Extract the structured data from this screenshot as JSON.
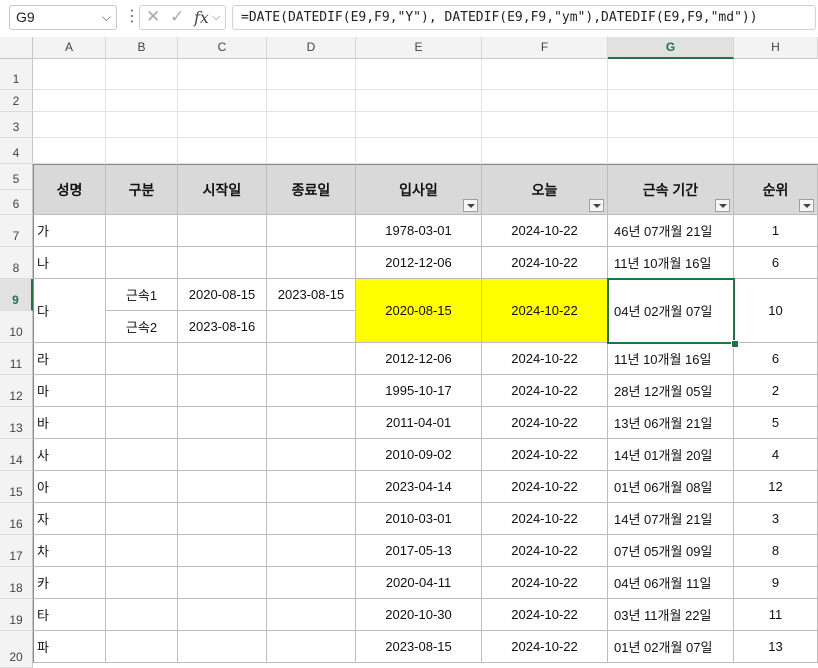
{
  "formula_bar": {
    "name_box": "G9",
    "formula": "=DATE(DATEDIF(E9,F9,\"Y\"), DATEDIF(E9,F9,\"ym\"),DATEDIF(E9,F9,\"md\"))",
    "fx_label": "fx"
  },
  "columns": [
    "A",
    "B",
    "C",
    "D",
    "E",
    "F",
    "G",
    "H"
  ],
  "selected_cell": "G9",
  "rows": [
    "1",
    "2",
    "3",
    "4",
    "5",
    "6",
    "7",
    "8",
    "9",
    "10",
    "11",
    "12",
    "13",
    "14",
    "15",
    "16",
    "17",
    "18",
    "19",
    "20"
  ],
  "table": {
    "headers": {
      "name": "성명",
      "category": "구분",
      "start": "시작일",
      "end": "종료일",
      "hire": "입사일",
      "today": "오늘",
      "tenure": "근속 기간",
      "rank": "순위"
    },
    "special": {
      "name": "다",
      "cat1": "근속1",
      "start1": "2020-08-15",
      "end1": "2023-08-15",
      "cat2": "근속2",
      "start2": "2023-08-16",
      "hire": "2020-08-15",
      "today": "2024-10-22",
      "tenure": "04년 02개월 07일",
      "rank": "10"
    },
    "rows": [
      {
        "name": "가",
        "hire": "1978-03-01",
        "today": "2024-10-22",
        "tenure": "46년 07개월 21일",
        "rank": "1"
      },
      {
        "name": "나",
        "hire": "2012-12-06",
        "today": "2024-10-22",
        "tenure": "11년 10개월 16일",
        "rank": "6"
      },
      {
        "name": "라",
        "hire": "2012-12-06",
        "today": "2024-10-22",
        "tenure": "11년 10개월 16일",
        "rank": "6"
      },
      {
        "name": "마",
        "hire": "1995-10-17",
        "today": "2024-10-22",
        "tenure": "28년 12개월 05일",
        "rank": "2"
      },
      {
        "name": "바",
        "hire": "2011-04-01",
        "today": "2024-10-22",
        "tenure": "13년 06개월 21일",
        "rank": "5"
      },
      {
        "name": "사",
        "hire": "2010-09-02",
        "today": "2024-10-22",
        "tenure": "14년 01개월 20일",
        "rank": "4"
      },
      {
        "name": "아",
        "hire": "2023-04-14",
        "today": "2024-10-22",
        "tenure": "01년 06개월 08일",
        "rank": "12"
      },
      {
        "name": "자",
        "hire": "2010-03-01",
        "today": "2024-10-22",
        "tenure": "14년 07개월 21일",
        "rank": "3"
      },
      {
        "name": "차",
        "hire": "2017-05-13",
        "today": "2024-10-22",
        "tenure": "07년 05개월 09일",
        "rank": "8"
      },
      {
        "name": "카",
        "hire": "2020-04-11",
        "today": "2024-10-22",
        "tenure": "04년 06개월 11일",
        "rank": "9"
      },
      {
        "name": "타",
        "hire": "2020-10-30",
        "today": "2024-10-22",
        "tenure": "03년 11개월 22일",
        "rank": "11"
      },
      {
        "name": "파",
        "hire": "2023-08-15",
        "today": "2024-10-22",
        "tenure": "01년 02개월 07일",
        "rank": "13"
      }
    ]
  },
  "colors": {
    "highlight": "#ffff00",
    "header_fill": "#d9d9d9",
    "selection": "#217346"
  }
}
